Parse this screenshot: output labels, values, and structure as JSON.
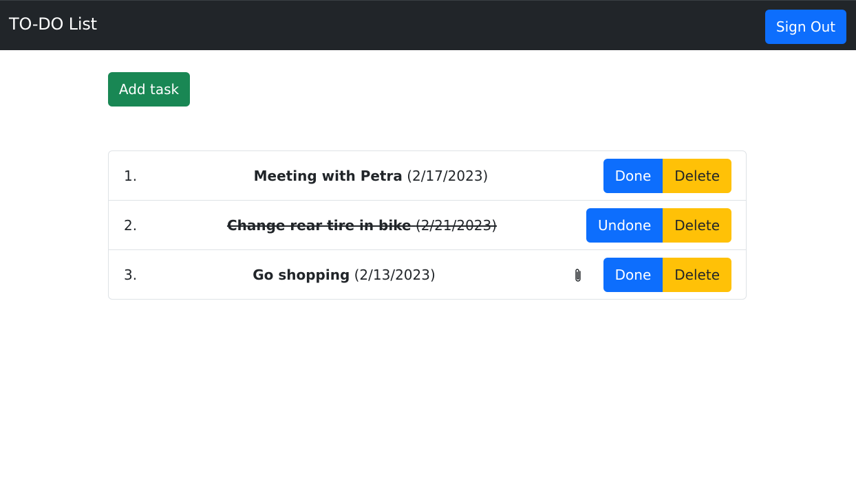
{
  "navbar": {
    "title": "TO-DO List",
    "sign_out_label": "Sign Out"
  },
  "toolbar": {
    "add_task_label": "Add task"
  },
  "tasks": [
    {
      "number": "1.",
      "title": "Meeting with Petra",
      "date": "(2/17/2023)",
      "done": false,
      "toggle_label": "Done",
      "delete_label": "Delete",
      "has_attachment": false
    },
    {
      "number": "2.",
      "title": "Change rear tire in bike",
      "date": "(2/21/2023)",
      "done": true,
      "toggle_label": "Undone",
      "delete_label": "Delete",
      "has_attachment": false
    },
    {
      "number": "3.",
      "title": "Go shopping",
      "date": "(2/13/2023)",
      "done": false,
      "toggle_label": "Done",
      "delete_label": "Delete",
      "has_attachment": true,
      "attachment_icon": "paperclip-icon"
    }
  ],
  "colors": {
    "navbar_bg": "#212529",
    "primary": "#0d6efd",
    "success": "#198754",
    "warning": "#ffc107",
    "border": "#dee2e6"
  }
}
